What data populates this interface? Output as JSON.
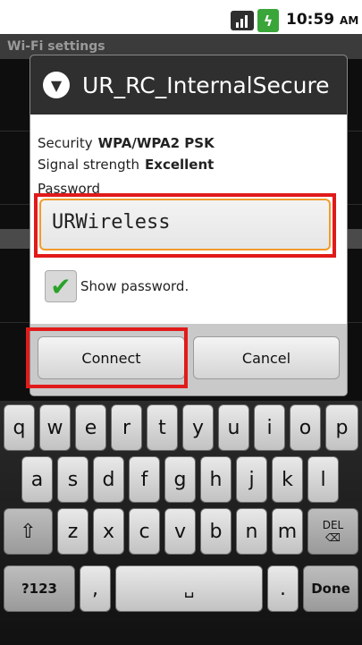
{
  "status_bar": {
    "time": "10:59",
    "ampm": "AM"
  },
  "background": {
    "title": "Wi-Fi settings"
  },
  "dialog": {
    "title": "UR_RC_InternalSecure",
    "security_label": "Security",
    "security_value": "WPA/WPA2 PSK",
    "signal_label": "Signal strength",
    "signal_value": "Excellent",
    "password_label": "Password",
    "password_value": "URWireless",
    "show_password_label": "Show password.",
    "connect_label": "Connect",
    "cancel_label": "Cancel"
  },
  "keyboard": {
    "row1": [
      "q",
      "w",
      "e",
      "r",
      "t",
      "y",
      "u",
      "i",
      "o",
      "p"
    ],
    "row2": [
      "a",
      "s",
      "d",
      "f",
      "g",
      "h",
      "j",
      "k",
      "l"
    ],
    "row3": [
      "z",
      "x",
      "c",
      "v",
      "b",
      "n",
      "m"
    ],
    "shift_glyph": "⇧",
    "del_label": "DEL",
    "sym_label": "?123",
    "comma": ",",
    "period": ".",
    "done_label": "Done"
  }
}
